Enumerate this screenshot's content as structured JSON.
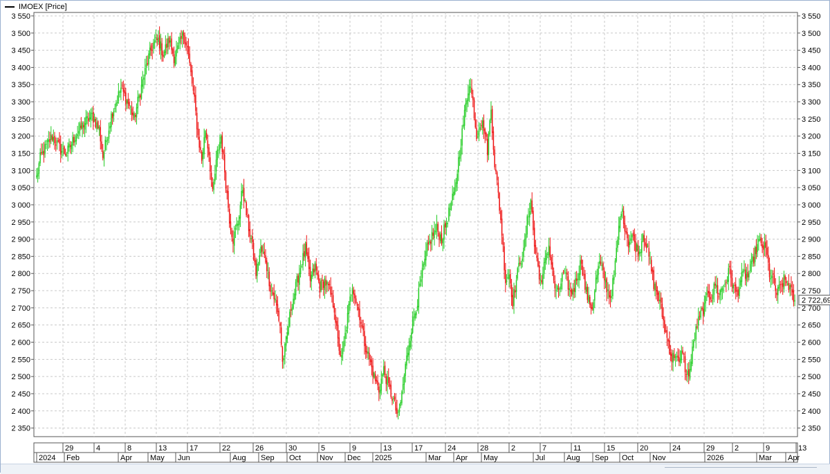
{
  "legend": {
    "label": "IMOEX [Price]"
  },
  "chart_data": {
    "type": "candlestick",
    "series_name": "IMOEX [Price]",
    "ylim": [
      2325,
      3560
    ],
    "y_ticks": [
      2350,
      2400,
      2450,
      2500,
      2550,
      2600,
      2650,
      2700,
      2750,
      2800,
      2850,
      2900,
      2950,
      3000,
      3050,
      3100,
      3150,
      3200,
      3250,
      3300,
      3350,
      3400,
      3450,
      3500,
      3550
    ],
    "y_tick_labels": [
      "2 350",
      "2 400",
      "2 450",
      "2 500",
      "2 550",
      "2 600",
      "2 650",
      "2 700",
      "2 750",
      "2 800",
      "2 850",
      "2 900",
      "2 950",
      "3 000",
      "3 050",
      "3 100",
      "3 150",
      "3 200",
      "3 250",
      "3 300",
      "3 350",
      "3 400",
      "3 450",
      "3 500",
      "3 550"
    ],
    "last_value": 2722.69,
    "last_value_label": "2 722,69",
    "x_axis_days": [
      "29",
      "4",
      "8",
      "13",
      "17",
      "22",
      "26",
      "30",
      "5",
      "9",
      "13",
      "17",
      "24",
      "28",
      "2",
      "7",
      "11",
      "15",
      "20",
      "24",
      "29",
      "2",
      "9",
      "13"
    ],
    "x_axis_months": [
      "2024",
      "Feb",
      "Apr",
      "May",
      "Jun",
      "Aug",
      "Sep",
      "Oct",
      "Nov",
      "Dec",
      "2025",
      "Mar",
      "Apr",
      "May",
      "Jul",
      "Aug",
      "Sep",
      "Oct",
      "Nov",
      "2026",
      "Mar",
      "Apr"
    ],
    "grid": true,
    "up_color": "#22cc22",
    "down_color": "#ee1111",
    "grid_color": "#c8c8c8",
    "path_points": [
      [
        0,
        3080
      ],
      [
        3,
        3135
      ],
      [
        8,
        3170
      ],
      [
        13,
        3200
      ],
      [
        20,
        3160
      ],
      [
        25,
        3150
      ],
      [
        32,
        3200
      ],
      [
        40,
        3240
      ],
      [
        46,
        3260
      ],
      [
        52,
        3220
      ],
      [
        55,
        3140
      ],
      [
        58,
        3190
      ],
      [
        62,
        3260
      ],
      [
        66,
        3300
      ],
      [
        70,
        3340
      ],
      [
        74,
        3310
      ],
      [
        78,
        3280
      ],
      [
        81,
        3250
      ],
      [
        84,
        3300
      ],
      [
        88,
        3360
      ],
      [
        93,
        3430
      ],
      [
        97,
        3470
      ],
      [
        101,
        3480
      ],
      [
        105,
        3440
      ],
      [
        110,
        3480
      ],
      [
        114,
        3430
      ],
      [
        118,
        3460
      ],
      [
        122,
        3500
      ],
      [
        125,
        3460
      ],
      [
        128,
        3380
      ],
      [
        131,
        3300
      ],
      [
        134,
        3200
      ],
      [
        137,
        3130
      ],
      [
        140,
        3220
      ],
      [
        143,
        3150
      ],
      [
        146,
        3030
      ],
      [
        150,
        3150
      ],
      [
        153,
        3200
      ],
      [
        156,
        3100
      ],
      [
        160,
        2960
      ],
      [
        163,
        2900
      ],
      [
        167,
        2950
      ],
      [
        171,
        3050
      ],
      [
        175,
        2950
      ],
      [
        178,
        2900
      ],
      [
        182,
        2800
      ],
      [
        186,
        2870
      ],
      [
        190,
        2840
      ],
      [
        194,
        2760
      ],
      [
        198,
        2720
      ],
      [
        202,
        2650
      ],
      [
        204,
        2540
      ],
      [
        207,
        2600
      ],
      [
        211,
        2700
      ],
      [
        215,
        2760
      ],
      [
        219,
        2820
      ],
      [
        223,
        2870
      ],
      [
        227,
        2780
      ],
      [
        231,
        2820
      ],
      [
        235,
        2760
      ],
      [
        239,
        2780
      ],
      [
        243,
        2750
      ],
      [
        247,
        2700
      ],
      [
        250,
        2600
      ],
      [
        253,
        2550
      ],
      [
        256,
        2620
      ],
      [
        259,
        2700
      ],
      [
        262,
        2770
      ],
      [
        265,
        2720
      ],
      [
        268,
        2680
      ],
      [
        272,
        2600
      ],
      [
        276,
        2550
      ],
      [
        280,
        2500
      ],
      [
        284,
        2460
      ],
      [
        288,
        2520
      ],
      [
        292,
        2470
      ],
      [
        296,
        2430
      ],
      [
        300,
        2380
      ],
      [
        303,
        2450
      ],
      [
        306,
        2530
      ],
      [
        309,
        2600
      ],
      [
        312,
        2660
      ],
      [
        316,
        2720
      ],
      [
        320,
        2800
      ],
      [
        324,
        2870
      ],
      [
        328,
        2910
      ],
      [
        332,
        2930
      ],
      [
        336,
        2900
      ],
      [
        340,
        2950
      ],
      [
        343,
        2990
      ],
      [
        347,
        3040
      ],
      [
        350,
        3130
      ],
      [
        353,
        3210
      ],
      [
        356,
        3290
      ],
      [
        359,
        3360
      ],
      [
        362,
        3300
      ],
      [
        365,
        3200
      ],
      [
        368,
        3240
      ],
      [
        371,
        3230
      ],
      [
        374,
        3160
      ],
      [
        377,
        3280
      ],
      [
        380,
        3120
      ],
      [
        383,
        3030
      ],
      [
        386,
        2920
      ],
      [
        389,
        2780
      ],
      [
        392,
        2800
      ],
      [
        395,
        2720
      ],
      [
        398,
        2780
      ],
      [
        401,
        2840
      ],
      [
        404,
        2860
      ],
      [
        407,
        2950
      ],
      [
        410,
        3020
      ],
      [
        413,
        2880
      ],
      [
        416,
        2820
      ],
      [
        419,
        2760
      ],
      [
        422,
        2850
      ],
      [
        425,
        2880
      ],
      [
        428,
        2800
      ],
      [
        431,
        2740
      ],
      [
        434,
        2760
      ],
      [
        437,
        2800
      ],
      [
        440,
        2780
      ],
      [
        443,
        2740
      ],
      [
        446,
        2760
      ],
      [
        449,
        2800
      ],
      [
        452,
        2840
      ],
      [
        455,
        2760
      ],
      [
        458,
        2720
      ],
      [
        461,
        2700
      ],
      [
        464,
        2780
      ],
      [
        467,
        2830
      ],
      [
        470,
        2800
      ],
      [
        473,
        2760
      ],
      [
        476,
        2730
      ],
      [
        479,
        2790
      ],
      [
        482,
        2900
      ],
      [
        485,
        2990
      ],
      [
        488,
        2940
      ],
      [
        491,
        2890
      ],
      [
        494,
        2910
      ],
      [
        497,
        2880
      ],
      [
        500,
        2860
      ],
      [
        503,
        2920
      ],
      [
        506,
        2880
      ],
      [
        509,
        2830
      ],
      [
        512,
        2770
      ],
      [
        515,
        2740
      ],
      [
        518,
        2700
      ],
      [
        521,
        2640
      ],
      [
        524,
        2600
      ],
      [
        527,
        2550
      ],
      [
        530,
        2570
      ],
      [
        533,
        2530
      ],
      [
        536,
        2580
      ],
      [
        539,
        2500
      ],
      [
        542,
        2520
      ],
      [
        545,
        2600
      ],
      [
        548,
        2650
      ],
      [
        551,
        2680
      ],
      [
        554,
        2700
      ],
      [
        557,
        2750
      ],
      [
        560,
        2730
      ],
      [
        563,
        2770
      ],
      [
        566,
        2740
      ],
      [
        569,
        2760
      ],
      [
        572,
        2780
      ],
      [
        575,
        2810
      ],
      [
        578,
        2760
      ],
      [
        581,
        2740
      ],
      [
        584,
        2780
      ],
      [
        587,
        2800
      ],
      [
        590,
        2790
      ],
      [
        593,
        2820
      ],
      [
        596,
        2860
      ],
      [
        599,
        2890
      ],
      [
        602,
        2880
      ],
      [
        605,
        2870
      ],
      [
        608,
        2800
      ],
      [
        611,
        2780
      ],
      [
        614,
        2740
      ],
      [
        617,
        2760
      ],
      [
        620,
        2780
      ],
      [
        623,
        2770
      ],
      [
        625,
        2760
      ],
      [
        627,
        2730
      ],
      [
        629,
        2722.69
      ]
    ]
  }
}
